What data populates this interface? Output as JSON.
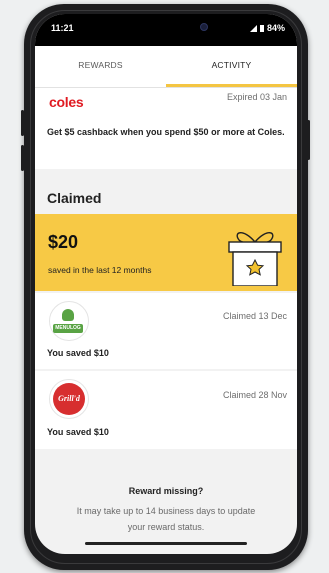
{
  "status_bar": {
    "time": "11:21",
    "battery": "84%"
  },
  "tabs": [
    {
      "label": "REWARDS",
      "active": false
    },
    {
      "label": "ACTIVITY",
      "active": true
    }
  ],
  "expired_offer": {
    "brand": "coles",
    "status": "Expired 03 Jan",
    "description": "Get $5 cashback when you spend $50 or more at Coles."
  },
  "claimed": {
    "section_title": "Claimed",
    "total_saved": "$20",
    "total_saved_note": "saved in the last 12 months",
    "items": [
      {
        "brand": "MENULOG",
        "status": "Claimed 13 Dec",
        "saved": "You saved $10"
      },
      {
        "brand": "Grill'd",
        "status": "Claimed 28 Nov",
        "saved": "You saved $10"
      }
    ]
  },
  "reward_missing": {
    "title": "Reward missing?",
    "body": "It may take up to 14 business days to update your reward status."
  },
  "colors": {
    "accent": "#f7c945",
    "coles_red": "#e01a22",
    "menulog_green": "#59a344",
    "grilld_red": "#d72e2f"
  }
}
